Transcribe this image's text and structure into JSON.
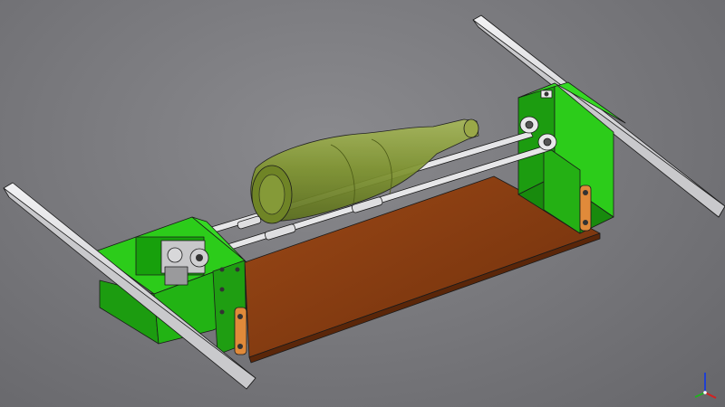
{
  "view": {
    "background_colors": [
      "#8a8a8e",
      "#66666a"
    ]
  },
  "model": {
    "parts": [
      {
        "name": "base-plate",
        "color": "#8a3e12"
      },
      {
        "name": "left-bracket",
        "color": "#22bb11"
      },
      {
        "name": "right-bracket",
        "color": "#22bb11"
      },
      {
        "name": "bottle",
        "color": "#7f9430"
      },
      {
        "name": "rails",
        "color": "#d8d8da"
      },
      {
        "name": "rods",
        "color": "#e6e6e8"
      },
      {
        "name": "spacers",
        "color": "#e08a3a"
      }
    ]
  },
  "axis_triad": {
    "x_color": "#d42020",
    "y_color": "#20b020",
    "z_color": "#2040d0"
  }
}
